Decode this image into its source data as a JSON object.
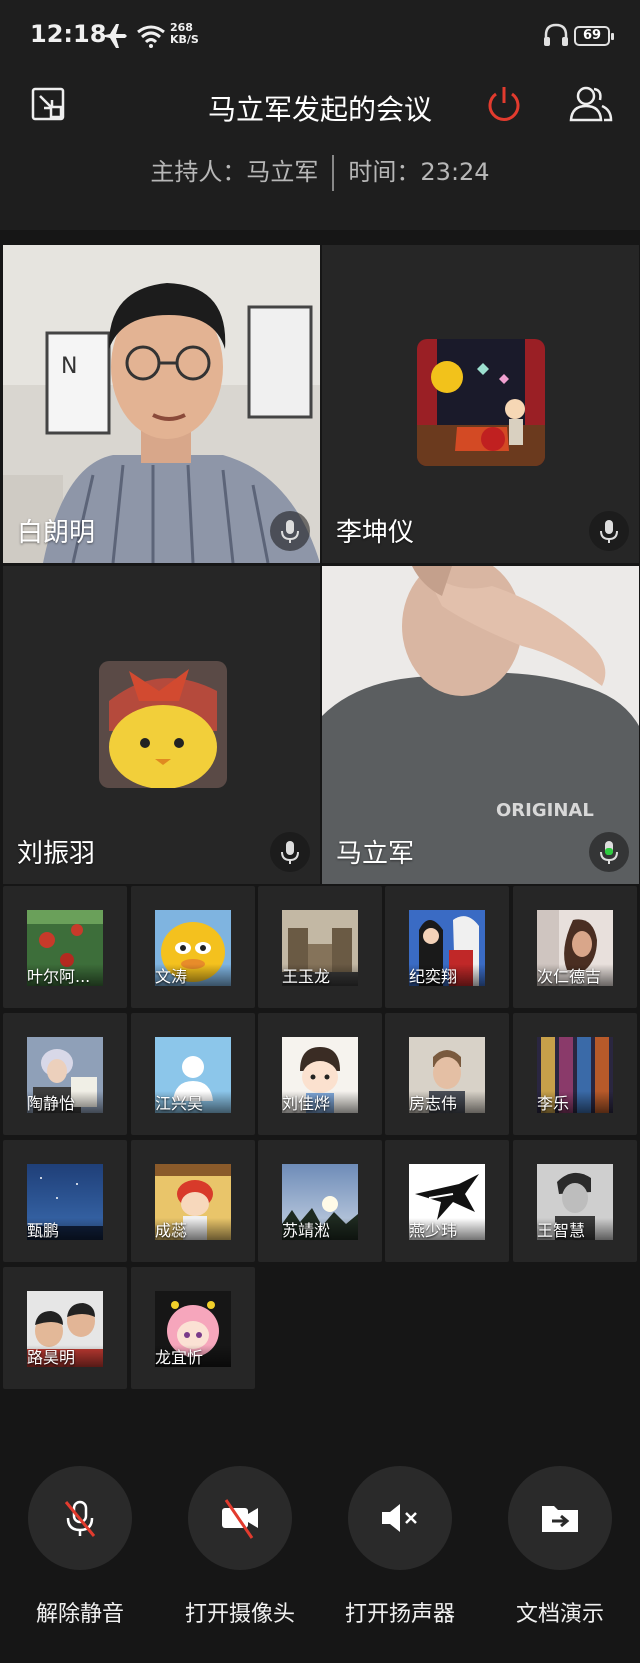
{
  "status_bar": {
    "time": "12:18",
    "net_speed_value": "268",
    "net_speed_unit": "KB/S",
    "battery": "69"
  },
  "header": {
    "title": "马立军发起的会议",
    "host_label": "主持人：马立军",
    "time_label": "时间：23:24",
    "power_color": "#e23b2e"
  },
  "video_tiles": [
    {
      "name": "白朗明",
      "mic": "mic-icon",
      "has_video": true
    },
    {
      "name": "李坤仪",
      "mic": "mic-icon",
      "has_video": false
    },
    {
      "name": "刘振羽",
      "mic": "mic-icon",
      "has_video": false
    },
    {
      "name": "马立军",
      "mic": "mic-active-icon",
      "has_video": true,
      "mic_color": "#2ecc40"
    }
  ],
  "thumbnails": [
    {
      "name": "叶尔阿..."
    },
    {
      "name": "文涛"
    },
    {
      "name": "王玉龙"
    },
    {
      "name": "纪奕翔"
    },
    {
      "name": "次仁德吉"
    },
    {
      "name": "陶静怡"
    },
    {
      "name": "江兴昊"
    },
    {
      "name": "刘佳烨"
    },
    {
      "name": "房志伟"
    },
    {
      "name": "李乐"
    },
    {
      "name": "甄鹏"
    },
    {
      "name": "成蕊"
    },
    {
      "name": "苏靖淞"
    },
    {
      "name": "燕少玮"
    },
    {
      "name": "王智慧"
    },
    {
      "name": "路昊明"
    },
    {
      "name": "龙宜忻"
    }
  ],
  "controls": {
    "unmute": "解除静音",
    "open_camera": "打开摄像头",
    "open_speaker": "打开扬声器",
    "doc_present": "文档演示"
  }
}
